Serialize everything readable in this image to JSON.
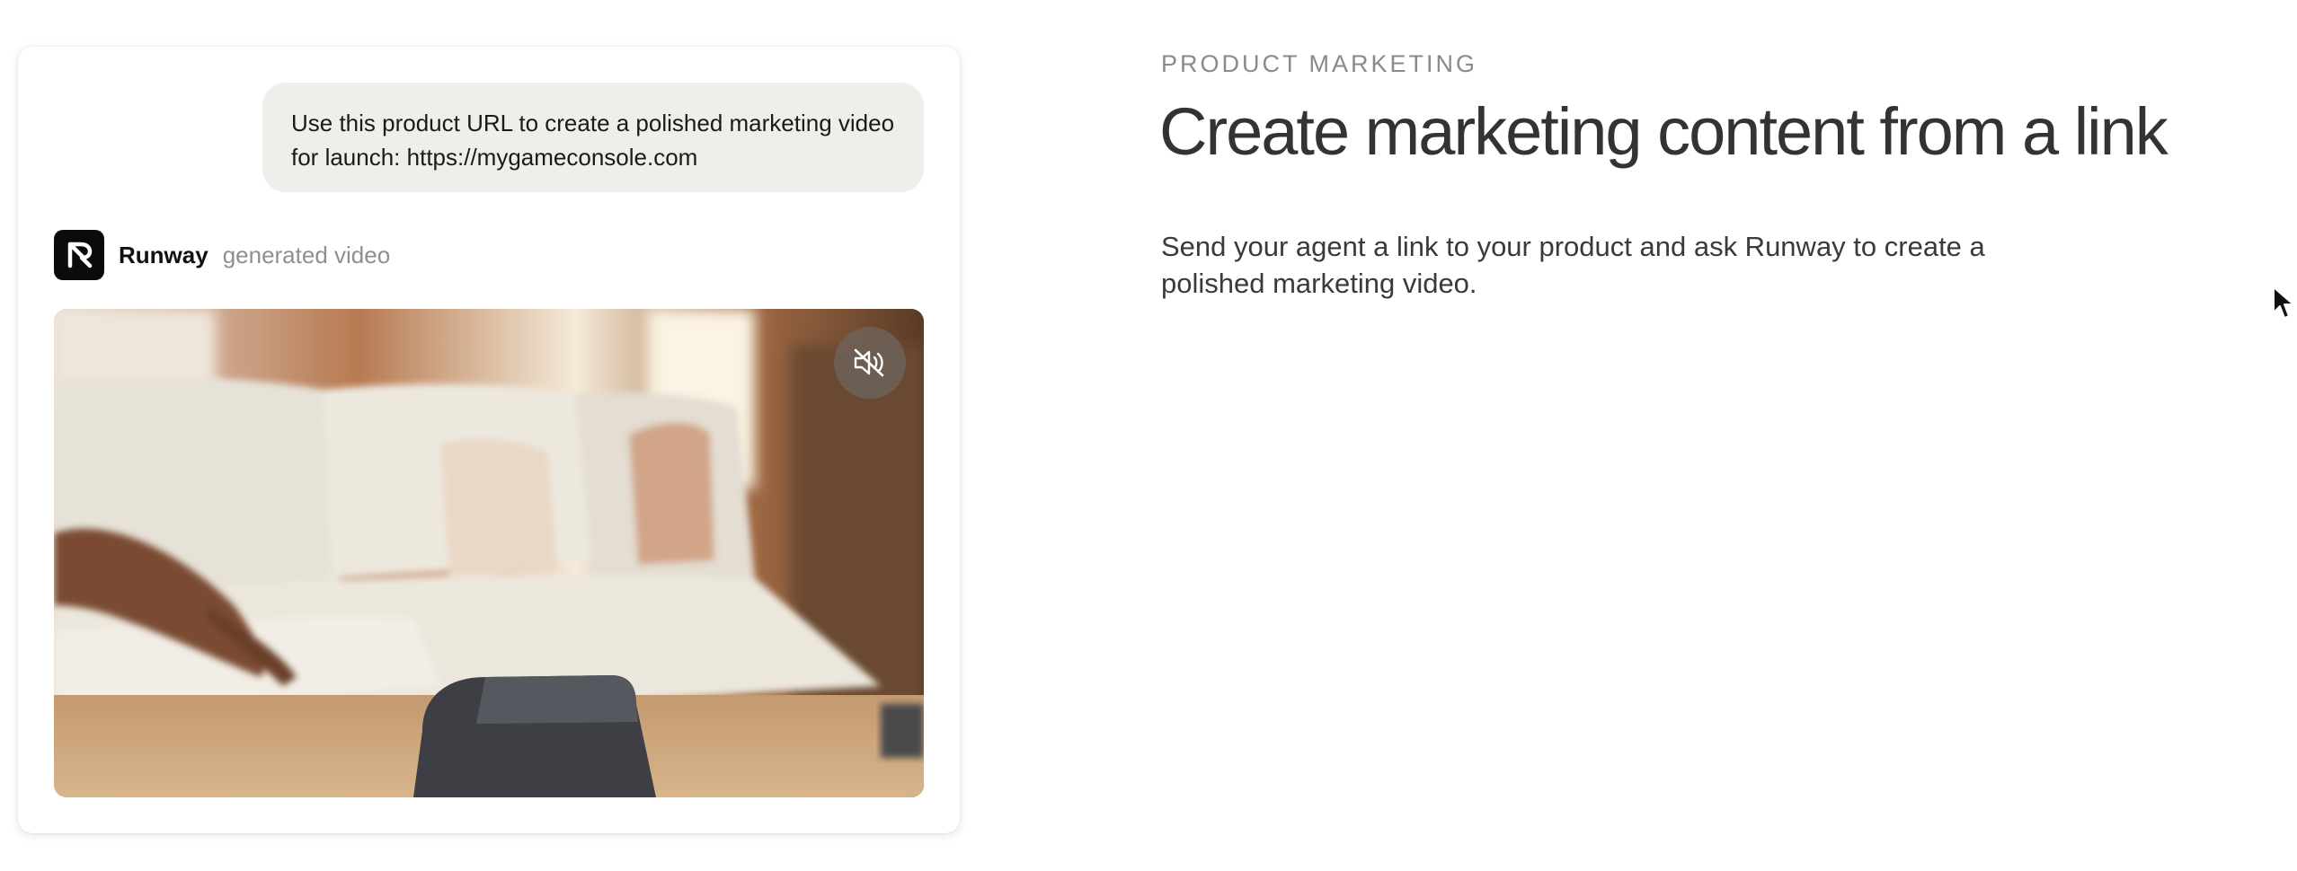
{
  "chat": {
    "user_message": "Use this product URL to create a polished marketing video for launch: https://mygameconsole.com",
    "agent": {
      "name": "Runway",
      "status": "generated video",
      "logo_icon": "runway-logo-icon"
    },
    "video": {
      "mute_icon": "volume-muted-icon"
    }
  },
  "content": {
    "eyebrow": "PRODUCT MARKETING",
    "headline": "Create marketing content from a link",
    "description": "Send your agent a link to your product and ask Runway to create a polished marketing video."
  },
  "colors": {
    "bubble_bg": "#efeeea",
    "logo_bg": "#0b0b0b",
    "headline": "#333333",
    "eyebrow": "#8a8a8a",
    "muted_text": "#8f8f8f"
  }
}
